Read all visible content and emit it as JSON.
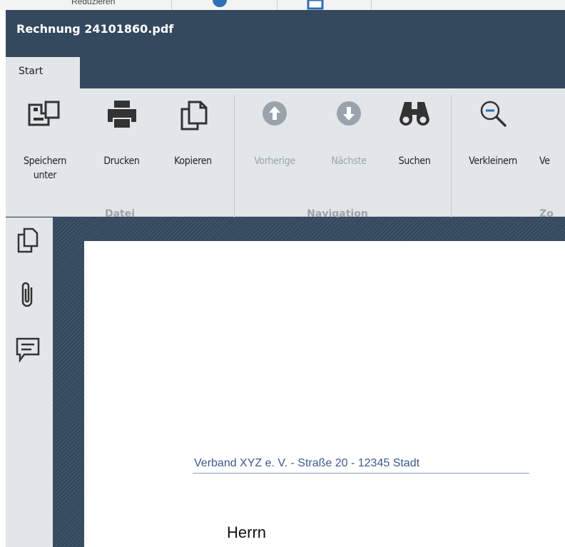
{
  "window": {
    "title": "Rechnung 24101860.pdf"
  },
  "tabs": [
    {
      "label": "Start"
    }
  ],
  "ribbon": {
    "groups": [
      {
        "label": "Datei",
        "buttons": [
          {
            "label_line1": "Speichern",
            "label_line2": "unter",
            "icon": "save-as-icon"
          },
          {
            "label": "Drucken",
            "icon": "printer-icon"
          },
          {
            "label": "Kopieren",
            "icon": "copy-icon"
          }
        ]
      },
      {
        "label": "Navigation",
        "buttons": [
          {
            "label": "Vorherige",
            "icon": "arrow-up-circle-icon",
            "enabled": false
          },
          {
            "label": "Nächste",
            "icon": "arrow-down-circle-icon",
            "enabled": false
          },
          {
            "label": "Suchen",
            "icon": "binoculars-icon",
            "enabled": true
          }
        ]
      },
      {
        "label": "Zo",
        "buttons": [
          {
            "label": "Verkleinern",
            "icon": "zoom-out-icon"
          },
          {
            "label": "Ve",
            "icon": ""
          }
        ]
      }
    ]
  },
  "sidebar": {
    "icons": [
      "pages-icon",
      "attachment-icon",
      "comment-icon"
    ]
  },
  "document": {
    "sender_line": "Verband XYZ e. V. - Straße 20 - 12345 Stadt",
    "addressee": "Herrn"
  },
  "background": {
    "partial_label": "Reduzieren"
  },
  "colors": {
    "titlebar": "#34495e",
    "ribbon": "#e3e6e8",
    "disabled": "#9aa3ac",
    "accent_blue": "#2f6fb3"
  }
}
